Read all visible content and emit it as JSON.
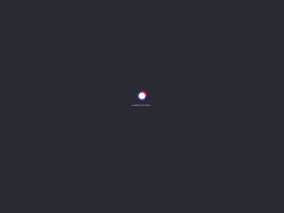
{
  "loading": {
    "message": "Loading Your File..."
  },
  "spinner": {
    "icon": "spinner-icon",
    "colors": {
      "ring_primary": "#3a3aa8",
      "ring_accent": "#e0203a",
      "center": "#ffffff",
      "background": "#2a2a33"
    }
  }
}
